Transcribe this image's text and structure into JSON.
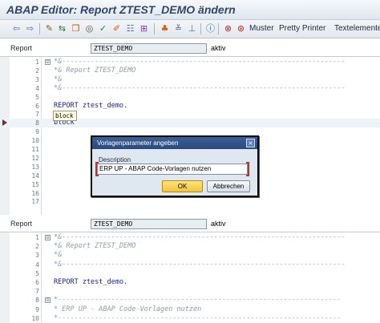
{
  "window": {
    "title": "ABAP Editor: Report ZTEST_DEMO ändern"
  },
  "toolbar": {
    "icons": [
      "back-arrow-icon",
      "forward-arrow-icon",
      "display-change-icon",
      "active-inactive-icon",
      "other-object-icon",
      "check-icon",
      "activate-icon",
      "where-used-icon",
      "object-list-icon",
      "navigation-window-icon",
      "enhance-icon",
      "info-icon",
      "breakpoint-icon",
      "external-breakpoint-icon"
    ],
    "muster_label": "Muster",
    "pretty_printer_label": "Pretty Printer",
    "textelemente_label": "Textelemente"
  },
  "top_pane": {
    "field_label": "Report",
    "field_value": "ZTEST_DEMO",
    "status": "aktiv",
    "lines": [
      {
        "num": "1",
        "fold": "⊟",
        "text": "*&---------------------------------------------------------------------",
        "type": "comment"
      },
      {
        "num": "2",
        "fold": "",
        "text": "*& Report ZTEST_DEMO",
        "type": "comment"
      },
      {
        "num": "3",
        "fold": "",
        "text": "*&",
        "type": "comment"
      },
      {
        "num": "4",
        "fold": "",
        "text": "*&---------------------------------------------------------------------",
        "type": "comment"
      },
      {
        "num": "5",
        "fold": "",
        "text": "",
        "type": "code"
      },
      {
        "num": "6",
        "fold": "",
        "text": "REPORT ztest_demo.",
        "type": "code"
      },
      {
        "num": "7",
        "fold": "",
        "text": "",
        "type": "code"
      },
      {
        "num": "8",
        "fold": "",
        "text": "block",
        "type": "code"
      },
      {
        "num": "9",
        "fold": "",
        "text": "",
        "type": "code"
      },
      {
        "num": "10",
        "fold": "",
        "text": "",
        "type": "code"
      },
      {
        "num": "11",
        "fold": "",
        "text": "",
        "type": "code"
      },
      {
        "num": "12",
        "fold": "",
        "text": "",
        "type": "code"
      },
      {
        "num": "13",
        "fold": "",
        "text": "",
        "type": "code"
      },
      {
        "num": "14",
        "fold": "",
        "text": "",
        "type": "code"
      },
      {
        "num": "15",
        "fold": "",
        "text": "",
        "type": "code"
      },
      {
        "num": "16",
        "fold": "",
        "text": "",
        "type": "code"
      },
      {
        "num": "17",
        "fold": "",
        "text": "",
        "type": "code"
      }
    ],
    "hint_text": "block"
  },
  "dialog": {
    "title": "Vorlagenparameter angeben",
    "close_label": "×",
    "description_label": "Description",
    "description_value": "ERP UP - ABAP Code-Vorlagen nutzen",
    "ok_label": "OK",
    "cancel_label": "Abbrechen"
  },
  "bottom_pane": {
    "field_label": "Report",
    "field_value": "ZTEST_DEMO",
    "status": "aktiv",
    "lines": [
      {
        "num": "1",
        "fold": "⊟",
        "text": "*&---------------------------------------------------------------------",
        "type": "comment"
      },
      {
        "num": "2",
        "fold": "",
        "text": "*& Report ZTEST_DEMO",
        "type": "comment"
      },
      {
        "num": "3",
        "fold": "",
        "text": "*&",
        "type": "comment"
      },
      {
        "num": "4",
        "fold": "",
        "text": "*&---------------------------------------------------------------------",
        "type": "comment"
      },
      {
        "num": "5",
        "fold": "",
        "text": "",
        "type": "code"
      },
      {
        "num": "6",
        "fold": "",
        "text": "REPORT ztest_demo.",
        "type": "code"
      },
      {
        "num": "7",
        "fold": "",
        "text": "",
        "type": "code"
      },
      {
        "num": "8",
        "fold": "⊟",
        "text": "*---------------------------------------------------------------------",
        "type": "comment"
      },
      {
        "num": "9",
        "fold": "",
        "text": "* ERP UP - ABAP Code-Vorlagen nutzen",
        "type": "comment"
      },
      {
        "num": "10",
        "fold": "",
        "text": "*---------------------------------------------------------------------",
        "type": "comment"
      }
    ]
  }
}
